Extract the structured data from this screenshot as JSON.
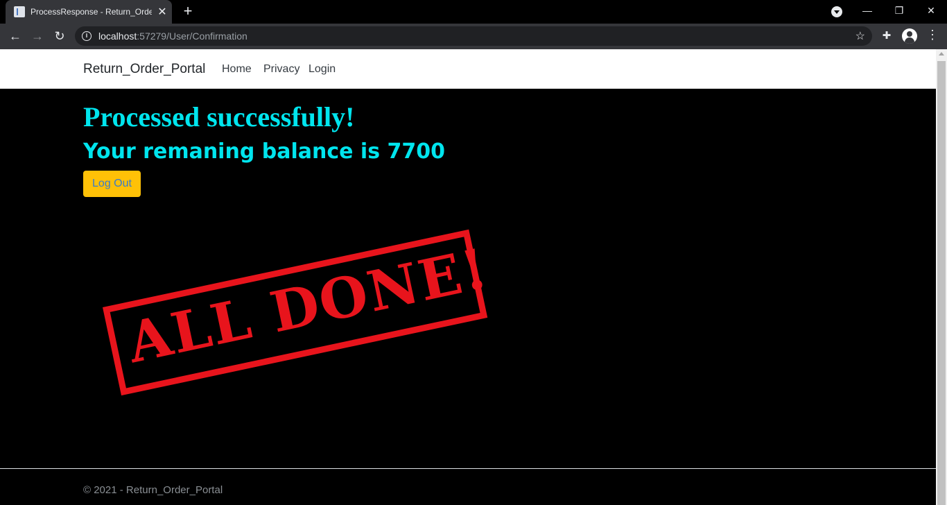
{
  "browser": {
    "tab_title": "ProcessResponse - Return_Order_Portal",
    "tab_close": "✕",
    "new_tab": "+",
    "url_host": "localhost",
    "url_rest": ":57279/User/Confirmation",
    "minimize": "—",
    "restore": "❐",
    "close": "✕",
    "back": "←",
    "forward": "→",
    "reload": "↻",
    "info": "i",
    "star": "☆",
    "ext": "✚",
    "menu": "⋮"
  },
  "navbar": {
    "brand": "Return_Order_Portal",
    "links": [
      "Home",
      "Privacy",
      "Login"
    ]
  },
  "main": {
    "title": "Processed successfully!",
    "balance_text": "Your remaning balance is 7700",
    "logout_label": "Log Out",
    "stamp_text": "ALL DONE!"
  },
  "footer": {
    "text": "© 2021 - Return_Order_Portal"
  },
  "colors": {
    "accent_text": "#00e5ee",
    "button_bg": "#ffc107",
    "stamp": "#e8141c"
  }
}
